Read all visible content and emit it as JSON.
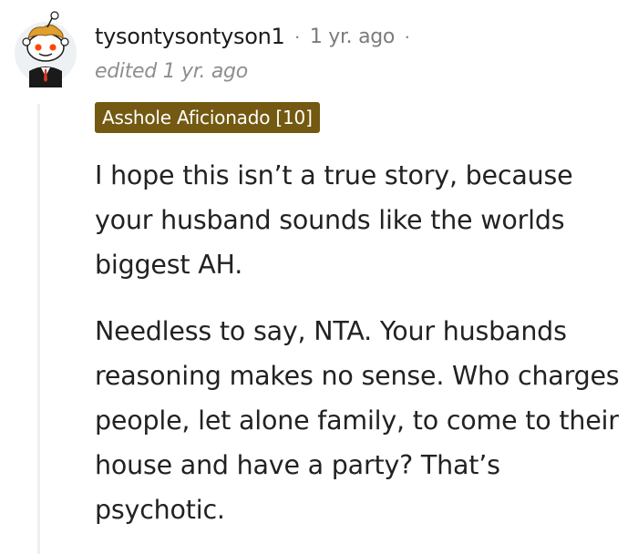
{
  "comment": {
    "author": "tysontysontyson1",
    "separator": "·",
    "timestamp": "1 yr. ago",
    "edited": "edited 1 yr. ago",
    "flair": "Asshole Aficionado [10]",
    "paragraphs": [
      "I hope this isn’t a true story, because your husband sounds like the worlds biggest AH.",
      "Needless to say, NTA. Your husbands reasoning makes no sense. Who charges people, let alone family, to come to their house and have a party? That’s psychotic."
    ]
  },
  "colors": {
    "flair_bg": "#735911",
    "text": "#1c1c1c",
    "meta": "#7c7c7c",
    "thread_line": "#edeff1"
  },
  "icons": {
    "avatar": "reddit-snoo-avatar-icon"
  }
}
